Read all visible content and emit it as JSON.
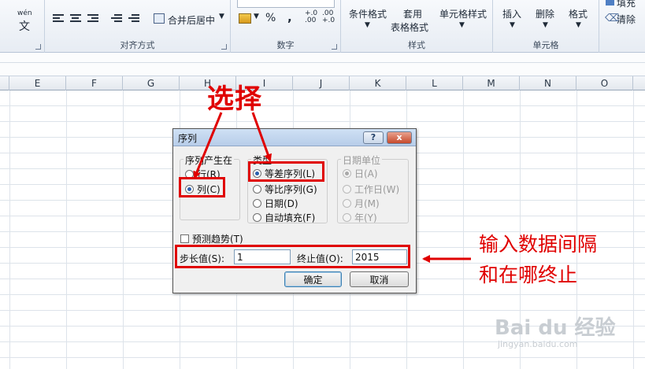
{
  "ribbon": {
    "groups": [
      {
        "label": "对齐方式"
      },
      {
        "label": "数字"
      },
      {
        "label": "样式"
      },
      {
        "label": "单元格"
      }
    ],
    "wen_label": "wén",
    "wen_char": "文",
    "merge_center": "合并后居中",
    "percent": "%",
    "comma": ",",
    "dec_inc": "+.0\n.00",
    "dec_dec": ".00\n+.0",
    "cond_format": "条件格式",
    "table_format_1": "套用",
    "table_format_2": "表格格式",
    "cell_style": "单元格样式",
    "insert": "插入",
    "delete": "删除",
    "format": "格式",
    "fill": "填充",
    "clear": "清除"
  },
  "columns": [
    "E",
    "F",
    "G",
    "H",
    "I",
    "J",
    "K",
    "L",
    "M",
    "N",
    "O"
  ],
  "dialog": {
    "title": "序列",
    "help_label": "?",
    "close_label": "x",
    "series_in": {
      "legend": "序列产生在",
      "options": [
        {
          "label": "行(R)",
          "selected": false
        },
        {
          "label": "列(C)",
          "selected": true
        }
      ]
    },
    "type": {
      "legend": "类型",
      "options": [
        {
          "label": "等差序列(L)",
          "selected": true
        },
        {
          "label": "等比序列(G)",
          "selected": false
        },
        {
          "label": "日期(D)",
          "selected": false
        },
        {
          "label": "自动填充(F)",
          "selected": false
        }
      ]
    },
    "date_unit": {
      "legend": "日期单位",
      "options": [
        {
          "label": "日(A)",
          "selected": true
        },
        {
          "label": "工作日(W)",
          "selected": false
        },
        {
          "label": "月(M)",
          "selected": false
        },
        {
          "label": "年(Y)",
          "selected": false
        }
      ]
    },
    "trend_label": "预测趋势(T)",
    "step_label": "步长值(S):",
    "step_value": "1",
    "stop_label": "终止值(O):",
    "stop_value": "2015",
    "ok_label": "确定",
    "cancel_label": "取消"
  },
  "annotations": {
    "select": "选择",
    "note_line1": "输入数据间隔",
    "note_line2": "和在哪终止",
    "color": "#e00000"
  },
  "watermark": {
    "brand": "Bai du 经验",
    "url": "jingyan.baidu.com"
  }
}
